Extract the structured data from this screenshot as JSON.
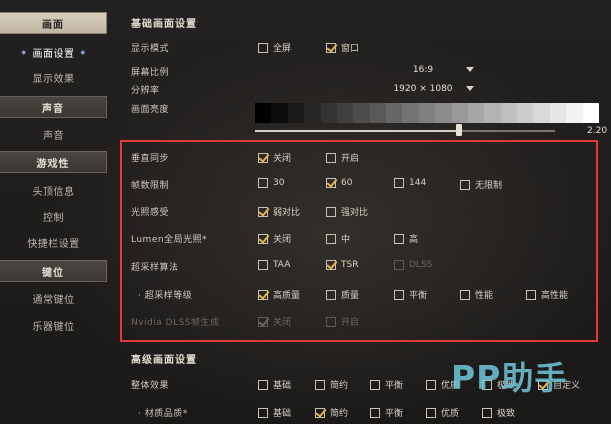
{
  "sidebar": {
    "groups": [
      {
        "label": "画面",
        "items": [
          {
            "label": "画面设置",
            "selected": true
          },
          {
            "label": "显示效果",
            "selected": false
          }
        ]
      },
      {
        "label": "声音",
        "items": [
          {
            "label": "声音",
            "selected": false
          }
        ]
      },
      {
        "label": "游戏性",
        "items": [
          {
            "label": "头顶信息",
            "selected": false
          },
          {
            "label": "控制",
            "selected": false
          },
          {
            "label": "快捷栏设置",
            "selected": false
          }
        ]
      },
      {
        "label": "键位",
        "items": [
          {
            "label": "通常键位",
            "selected": false
          },
          {
            "label": "乐器键位",
            "selected": false
          }
        ]
      }
    ]
  },
  "basic": {
    "title": "基础画面设置",
    "display_mode": {
      "label": "显示模式",
      "options": [
        {
          "label": "全屏",
          "checked": false
        },
        {
          "label": "窗口",
          "checked": true
        }
      ]
    },
    "aspect_ratio": {
      "label": "屏幕比例",
      "value": "16:9"
    },
    "resolution": {
      "label": "分辨率",
      "value": "1920 × 1080"
    },
    "brightness": {
      "label": "画面亮度",
      "value": "2.20",
      "fraction": 0.68
    }
  },
  "highlighted": {
    "vsync": {
      "label": "垂直同步",
      "options": [
        {
          "label": "关闭",
          "checked": true
        },
        {
          "label": "开启",
          "checked": false
        }
      ]
    },
    "fps_limit": {
      "label": "帧数限制",
      "options": [
        {
          "label": "30",
          "checked": false
        },
        {
          "label": "60",
          "checked": true
        },
        {
          "label": "144",
          "checked": false
        },
        {
          "label": "无限制",
          "checked": false
        }
      ]
    },
    "light_sense": {
      "label": "光照感受",
      "options": [
        {
          "label": "弱对比",
          "checked": true
        },
        {
          "label": "强对比",
          "checked": false
        }
      ]
    },
    "lumen": {
      "label": "Lumen全局光照*",
      "options": [
        {
          "label": "关闭",
          "checked": true
        },
        {
          "label": "中",
          "checked": false
        },
        {
          "label": "高",
          "checked": false
        }
      ]
    },
    "upscale_algo": {
      "label": "超采样算法",
      "options": [
        {
          "label": "TAA",
          "checked": false
        },
        {
          "label": "TSR",
          "checked": true
        },
        {
          "label": "DLSS",
          "checked": false,
          "disabled": true
        }
      ]
    },
    "upscale_level": {
      "label": "超采样等级",
      "options": [
        {
          "label": "高质量",
          "checked": true
        },
        {
          "label": "质量",
          "checked": false
        },
        {
          "label": "平衡",
          "checked": false
        },
        {
          "label": "性能",
          "checked": false
        },
        {
          "label": "高性能",
          "checked": false
        }
      ]
    },
    "dlss_framegen": {
      "label": "Nvidia DLSS帧生成",
      "options": [
        {
          "label": "关闭",
          "checked": true
        },
        {
          "label": "开启",
          "checked": false
        }
      ]
    }
  },
  "advanced": {
    "title": "高级画面设置",
    "overall": {
      "label": "整体效果",
      "options": [
        {
          "label": "基础",
          "checked": false
        },
        {
          "label": "简约",
          "checked": false
        },
        {
          "label": "平衡",
          "checked": false
        },
        {
          "label": "优质",
          "checked": false
        },
        {
          "label": "极致",
          "checked": false
        },
        {
          "label": "自定义",
          "checked": true
        }
      ]
    },
    "material": {
      "label": "材质品质*",
      "options": [
        {
          "label": "基础",
          "checked": false
        },
        {
          "label": "简约",
          "checked": true
        },
        {
          "label": "平衡",
          "checked": false
        },
        {
          "label": "优质",
          "checked": false
        },
        {
          "label": "极致",
          "checked": false
        }
      ]
    }
  },
  "watermark": {
    "latin": "PP",
    "han": "助手"
  },
  "colors": {
    "accent_check": "#e4b44a",
    "highlight_border": "#e03a3a",
    "watermark": "#6ec8dc"
  }
}
